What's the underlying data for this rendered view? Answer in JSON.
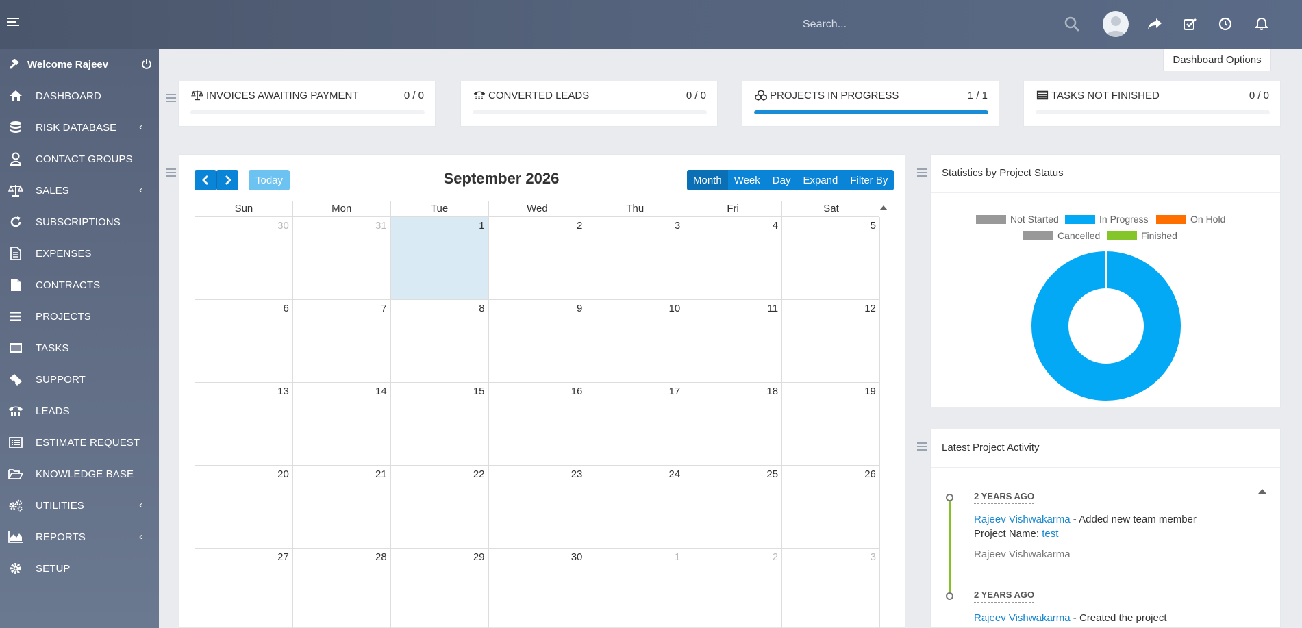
{
  "header": {
    "search_placeholder": "Search...",
    "icons": [
      "search-icon",
      "avatar",
      "share-icon",
      "checkbox-icon",
      "clock-icon",
      "bell-icon"
    ]
  },
  "sidebar": {
    "welcome": "Welcome Rajeev",
    "items": [
      {
        "label": "DASHBOARD",
        "icon": "home-icon",
        "caret": false
      },
      {
        "label": "RISK DATABASE",
        "icon": "database-icon",
        "caret": true
      },
      {
        "label": "CONTACT GROUPS",
        "icon": "user-icon",
        "caret": false
      },
      {
        "label": "SALES",
        "icon": "balance-scale-icon",
        "caret": true
      },
      {
        "label": "SUBSCRIPTIONS",
        "icon": "refresh-icon",
        "caret": false
      },
      {
        "label": "EXPENSES",
        "icon": "file-text-icon",
        "caret": false
      },
      {
        "label": "CONTRACTS",
        "icon": "file-icon",
        "caret": false
      },
      {
        "label": "PROJECTS",
        "icon": "bars-icon",
        "caret": false
      },
      {
        "label": "TASKS",
        "icon": "tasks-icon",
        "caret": false
      },
      {
        "label": "SUPPORT",
        "icon": "ticket-icon",
        "caret": false
      },
      {
        "label": "LEADS",
        "icon": "tty-icon",
        "caret": false
      },
      {
        "label": "ESTIMATE REQUEST",
        "icon": "list-alt-icon",
        "caret": false
      },
      {
        "label": "KNOWLEDGE BASE",
        "icon": "folder-open-icon",
        "caret": false
      },
      {
        "label": "UTILITIES",
        "icon": "cogs-icon",
        "caret": true
      },
      {
        "label": "REPORTS",
        "icon": "area-chart-icon",
        "caret": true
      },
      {
        "label": "SETUP",
        "icon": "gear-icon",
        "caret": false
      }
    ]
  },
  "dashboard_options": "Dashboard Options",
  "stats": [
    {
      "title": "INVOICES AWAITING PAYMENT",
      "value": "0 / 0",
      "progress": 0,
      "icon": "balance-scale-icon"
    },
    {
      "title": "CONVERTED LEADS",
      "value": "0 / 0",
      "progress": 0,
      "icon": "tty-icon"
    },
    {
      "title": "PROJECTS IN PROGRESS",
      "value": "1 / 1",
      "progress": 1,
      "icon": "cubes-icon"
    },
    {
      "title": "TASKS NOT FINISHED",
      "value": "0 / 0",
      "progress": 0,
      "icon": "list-icon"
    }
  ],
  "calendar": {
    "title": "September 2026",
    "today_label": "Today",
    "views": [
      "Month",
      "Week",
      "Day",
      "Expand",
      "Filter By"
    ],
    "active_view": "Month",
    "weekdays": [
      "Sun",
      "Mon",
      "Tue",
      "Wed",
      "Thu",
      "Fri",
      "Sat"
    ],
    "days": [
      {
        "d": "30",
        "other": true
      },
      {
        "d": "31",
        "other": true
      },
      {
        "d": "1",
        "today": true
      },
      {
        "d": "2"
      },
      {
        "d": "3"
      },
      {
        "d": "4"
      },
      {
        "d": "5"
      },
      {
        "d": "6"
      },
      {
        "d": "7"
      },
      {
        "d": "8"
      },
      {
        "d": "9"
      },
      {
        "d": "10"
      },
      {
        "d": "11"
      },
      {
        "d": "12"
      },
      {
        "d": "13"
      },
      {
        "d": "14"
      },
      {
        "d": "15"
      },
      {
        "d": "16"
      },
      {
        "d": "17"
      },
      {
        "d": "18"
      },
      {
        "d": "19"
      },
      {
        "d": "20"
      },
      {
        "d": "21"
      },
      {
        "d": "22"
      },
      {
        "d": "23"
      },
      {
        "d": "24"
      },
      {
        "d": "25"
      },
      {
        "d": "26"
      },
      {
        "d": "27"
      },
      {
        "d": "28"
      },
      {
        "d": "29"
      },
      {
        "d": "30"
      },
      {
        "d": "1",
        "other": true
      },
      {
        "d": "2",
        "other": true
      },
      {
        "d": "3",
        "other": true
      }
    ]
  },
  "project_status": {
    "title": "Statistics by Project Status",
    "legend": [
      {
        "label": "Not Started",
        "color": "#999999"
      },
      {
        "label": "In Progress",
        "color": "#03a9f4"
      },
      {
        "label": "On Hold",
        "color": "#ff6f00"
      },
      {
        "label": "Cancelled",
        "color": "#999999"
      },
      {
        "label": "Finished",
        "color": "#84c529"
      }
    ]
  },
  "chart_data": {
    "type": "pie",
    "categories": [
      "Not Started",
      "In Progress",
      "On Hold",
      "Cancelled",
      "Finished"
    ],
    "values": [
      0,
      1,
      0,
      0,
      0
    ],
    "title": "Statistics by Project Status"
  },
  "activity": {
    "title": "Latest Project Activity",
    "items": [
      {
        "when": "2 YEARS AGO",
        "user": "Rajeev Vishwakarma",
        "action": " - Added new team member",
        "project_label": "Project Name: ",
        "project": "test",
        "by": "Rajeev Vishwakarma"
      },
      {
        "when": "2 YEARS AGO",
        "user": "Rajeev Vishwakarma",
        "action": " - Created the project"
      }
    ]
  },
  "colors": {
    "accent": "#0a84d6",
    "progress": "#1b8dd6",
    "today_cell": "#d9eaf5",
    "timeline": "#84c225"
  }
}
